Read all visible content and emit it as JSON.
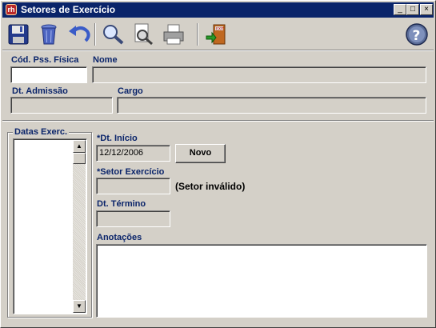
{
  "window": {
    "title": "Setores de Exercício",
    "app_badge": "rh",
    "controls": {
      "minimize": "_",
      "maximize": "□",
      "close": "×"
    }
  },
  "toolbar": {
    "icons": [
      "save-icon",
      "delete-icon",
      "undo-icon",
      "search-icon",
      "print-preview-icon",
      "print-icon",
      "exit-icon",
      "help-icon"
    ],
    "exit_badge": "EXIT",
    "help_symbol": "?"
  },
  "header": {
    "cod_label": "Cód. Pss. Física",
    "cod_value": "",
    "nome_label": "Nome",
    "nome_value": "",
    "admissao_label": "Dt. Admissão",
    "admissao_value": "",
    "cargo_label": "Cargo",
    "cargo_value": ""
  },
  "datas": {
    "group_title": "Datas Exerc.",
    "items": [],
    "scroll_up": "▲",
    "scroll_down": "▼"
  },
  "form": {
    "inicio_label": "*Dt. Início",
    "inicio_value": "12/12/2006",
    "novo_button": "Novo",
    "setor_label": "*Setor Exercício",
    "setor_value": "",
    "setor_status": "(Setor inválido)",
    "termino_label": "Dt. Término",
    "termino_value": "",
    "anotacoes_label": "Anotações",
    "anotacoes_value": ""
  }
}
